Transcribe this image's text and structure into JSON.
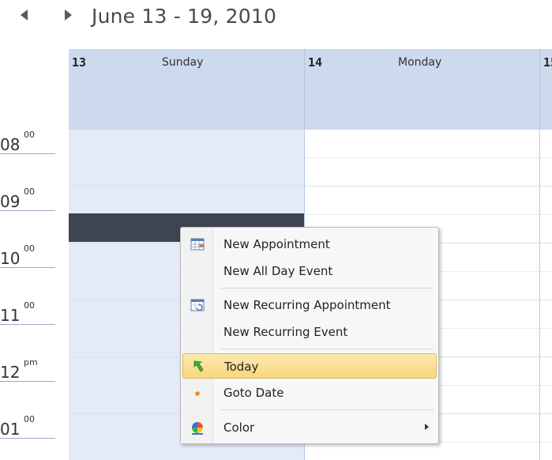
{
  "header": {
    "date_range": "June 13 - 19, 2010"
  },
  "days": [
    {
      "num": "13",
      "name": "Sunday"
    },
    {
      "num": "14",
      "name": "Monday"
    },
    {
      "num": "15",
      "name": ""
    }
  ],
  "hours": [
    {
      "num": "08",
      "suffix": "00"
    },
    {
      "num": "09",
      "suffix": "00"
    },
    {
      "num": "10",
      "suffix": "00"
    },
    {
      "num": "11",
      "suffix": "00"
    },
    {
      "num": "12",
      "suffix": "pm"
    },
    {
      "num": "01",
      "suffix": "00"
    }
  ],
  "context_menu": {
    "items": [
      {
        "label": "New Appointment",
        "icon": "calendar-grid-icon"
      },
      {
        "label": "New All Day Event",
        "icon": ""
      },
      {
        "label": "New Recurring Appointment",
        "icon": "recurring-calendar-icon"
      },
      {
        "label": "New Recurring Event",
        "icon": ""
      },
      {
        "label": "Today",
        "icon": "green-arrow-icon"
      },
      {
        "label": "Goto Date",
        "icon": "orange-dot-icon"
      },
      {
        "label": "Color",
        "icon": "color-wheel-icon"
      }
    ]
  },
  "colors": {
    "header_bg": "#cdd9ec",
    "sunday_bg": "#e4ebf6",
    "selection": "#3e4551",
    "highlight": "#f8d77e"
  }
}
